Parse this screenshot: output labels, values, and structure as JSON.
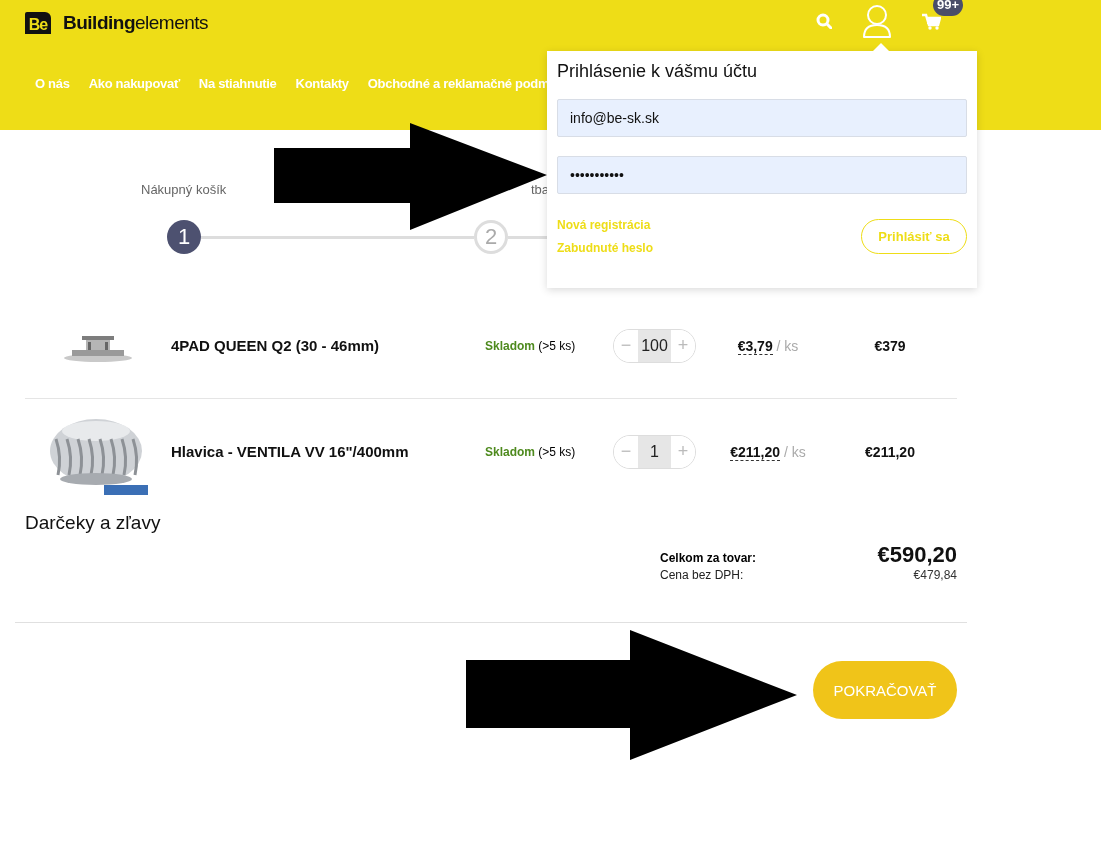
{
  "header": {
    "logo_mark": "Be",
    "logo_bold": "Building",
    "logo_light": "elements",
    "cart_badge": "99+",
    "nav": [
      "O nás",
      "Ako nakupovať",
      "Na stiahnutie",
      "Kontakty",
      "Obchodné a reklamačné podm"
    ]
  },
  "steps": [
    {
      "number": "1",
      "label": "Nákupný košík",
      "selected": true
    },
    {
      "number": "2",
      "label": "tba",
      "selected": false
    }
  ],
  "cart": {
    "rows": [
      {
        "name": "4PAD QUEEN Q2 (30 - 46mm)",
        "stock": "Skladom",
        "stock_note": "(>5 ks)",
        "minus": "−",
        "quantity": "100",
        "plus": "+",
        "unit_price": "€3,79",
        "unit": "/ ks",
        "total": "€379"
      },
      {
        "name": "Hlavica - VENTILA VV 16\"/400mm",
        "stock": "Skladom",
        "stock_note": "(>5 ks)",
        "minus": "−",
        "quantity": "1",
        "plus": "+",
        "unit_price": "€211,20",
        "unit": "/ ks",
        "total": "€211,20"
      }
    ]
  },
  "gifts_heading": "Darčeky a zľavy",
  "totals": [
    {
      "kind": "total",
      "label": "Celkom za tovar:",
      "value": "€590,20"
    },
    {
      "kind": "net",
      "label": "Cena bez DPH:",
      "value": "€479,84"
    }
  ],
  "continue_button": "POKRAČOVAŤ",
  "login_popup": {
    "title": "Prihlásenie k vášmu účtu",
    "email": {
      "value": "info@be-sk.sk"
    },
    "password": {
      "value": "•••••••••••"
    },
    "links": [
      "Nová registrácia",
      "Zabudnuté heslo"
    ],
    "submit": "Prihlásiť sa"
  },
  "annotations": [
    {
      "kind": "arrow"
    },
    {
      "kind": "arrow"
    }
  ]
}
